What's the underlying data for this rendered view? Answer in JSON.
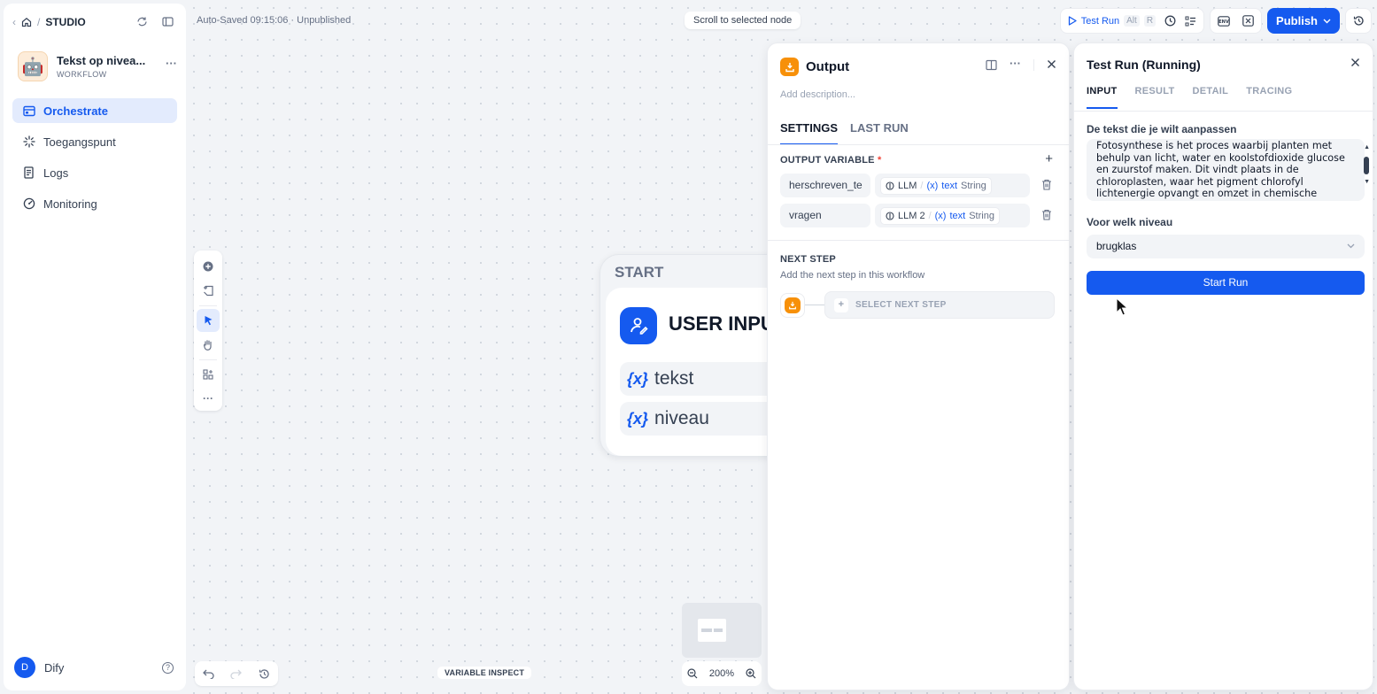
{
  "breadcrumb": {
    "separator": "/",
    "section": "STUDIO"
  },
  "app": {
    "name": "Tekst op nivea...",
    "type": "WORKFLOW",
    "more": "···"
  },
  "nav": [
    {
      "label": "Orchestrate",
      "icon": "layout-icon",
      "active": true
    },
    {
      "label": "Toegangspunt",
      "icon": "access-point-icon",
      "active": false
    },
    {
      "label": "Logs",
      "icon": "logs-icon",
      "active": false
    },
    {
      "label": "Monitoring",
      "icon": "monitoring-icon",
      "active": false
    }
  ],
  "user": {
    "initial": "D",
    "name": "Dify",
    "help": "?"
  },
  "topbar": {
    "autosave": "Auto-Saved 09:15:06 · Unpublished",
    "scroll_to_selected": "Scroll to selected node",
    "test_run": "Test Run",
    "test_run_key1": "Alt",
    "test_run_key2": "R",
    "publish": "Publish"
  },
  "canvas": {
    "zoom": "200%",
    "variable_inspect": "VARIABLE INSPECT"
  },
  "start_node": {
    "label": "START",
    "title": "USER INPUT",
    "variables": [
      {
        "symbol": "{x}",
        "name": "tekst"
      },
      {
        "symbol": "{x}",
        "name": "niveau"
      }
    ]
  },
  "output_panel": {
    "title": "Output",
    "description_placeholder": "Add description...",
    "tabs": [
      "SETTINGS",
      "LAST RUN"
    ],
    "output_variable_label": "OUTPUT VARIABLE",
    "required_mark": "*",
    "rows": [
      {
        "name": "herschreven_te",
        "node": "LLM",
        "var_symbol": "(x)",
        "var": "text",
        "type": "String"
      },
      {
        "name": "vragen",
        "node": "LLM 2",
        "var_symbol": "(x)",
        "var": "text",
        "type": "String"
      }
    ],
    "next_step_title": "NEXT STEP",
    "next_step_desc": "Add the next step in this workflow",
    "select_next_step": "SELECT NEXT STEP"
  },
  "test_panel": {
    "title": "Test Run (Running)",
    "tabs": [
      "INPUT",
      "RESULT",
      "DETAIL",
      "TRACING"
    ],
    "field1_label": "De tekst die je wilt aanpassen",
    "field1_value": "Fotosynthese is het proces waarbij planten met behulp van licht, water en koolstofdioxide glucose en zuurstof maken. Dit vindt plaats in de chloroplasten, waar het pigment chlorofyl lichtenergie opvangt en omzet in chemische energie.",
    "field2_label": "Voor welk niveau",
    "field2_value": "brugklas",
    "start_run": "Start Run"
  },
  "colors": {
    "accent": "#155aef",
    "output_icon": "#f79009",
    "required": "#f04438"
  }
}
